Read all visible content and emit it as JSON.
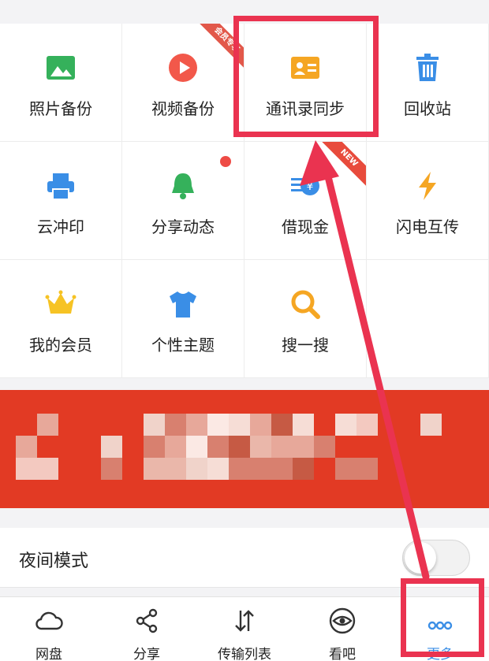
{
  "grid": {
    "items": [
      {
        "label": "照片备份",
        "icon": "photo-icon"
      },
      {
        "label": "视频备份",
        "icon": "video-play-icon",
        "badge": "会员专享"
      },
      {
        "label": "通讯录同步",
        "icon": "contact-card-icon"
      },
      {
        "label": "回收站",
        "icon": "trash-icon"
      },
      {
        "label": "云冲印",
        "icon": "printer-icon"
      },
      {
        "label": "分享动态",
        "icon": "bell-icon",
        "dot": true
      },
      {
        "label": "借现金",
        "icon": "cash-icon",
        "badge": "NEW"
      },
      {
        "label": "闪电互传",
        "icon": "lightning-icon"
      },
      {
        "label": "我的会员",
        "icon": "crown-icon"
      },
      {
        "label": "个性主题",
        "icon": "tshirt-icon"
      },
      {
        "label": "搜一搜",
        "icon": "search-icon"
      }
    ]
  },
  "settings": {
    "night_mode_label": "夜间模式",
    "night_mode_on": false
  },
  "tabbar": {
    "tabs": [
      {
        "label": "网盘",
        "icon": "cloud-icon"
      },
      {
        "label": "分享",
        "icon": "share-icon"
      },
      {
        "label": "传输列表",
        "icon": "transfer-icon"
      },
      {
        "label": "看吧",
        "icon": "eye-icon"
      },
      {
        "label": "更多",
        "icon": "more-dots-icon",
        "active": true
      }
    ]
  },
  "colors": {
    "accent_blue": "#3a8ee6",
    "highlight": "#ea3350",
    "banner_red": "#e23a24"
  }
}
